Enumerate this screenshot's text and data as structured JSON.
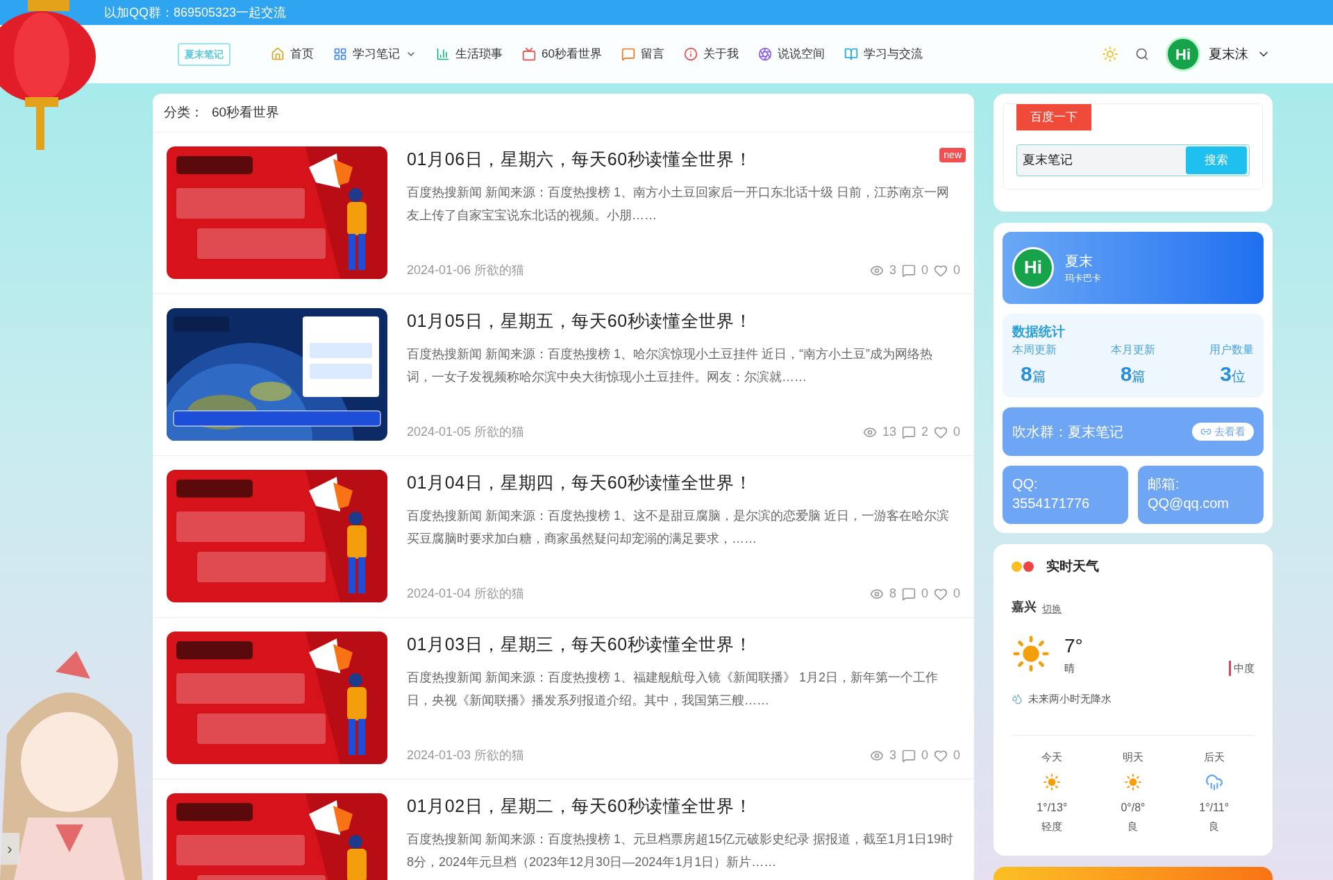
{
  "top_banner": "以加QQ群：869505323一起交流",
  "logo": "夏末笔记",
  "nav": [
    {
      "label": "首页",
      "dropdown": false
    },
    {
      "label": "学习笔记",
      "dropdown": true
    },
    {
      "label": "生活琐事",
      "dropdown": false
    },
    {
      "label": "60秒看世界",
      "dropdown": false
    },
    {
      "label": "留言",
      "dropdown": false
    },
    {
      "label": "关于我",
      "dropdown": false
    },
    {
      "label": "说说空间",
      "dropdown": false
    },
    {
      "label": "学习与交流",
      "dropdown": false
    }
  ],
  "user": {
    "avatar": "Hi",
    "name": "夏末沫"
  },
  "category": {
    "label": "分类：",
    "value": "60秒看世界"
  },
  "articles": [
    {
      "title": "01月06日，星期六，每天60秒读懂全世界！",
      "excerpt": "百度热搜新闻 新闻来源：百度热搜榜 1、南方小土豆回家后一开口东北话十级 日前，江苏南京一网友上传了自家宝宝说东北话的视频。小朋……",
      "date": "2024-01-06",
      "author": "所欲的猫",
      "views": "3",
      "comments": "0",
      "likes": "0",
      "badge": "new"
    },
    {
      "title": "01月05日，星期五，每天60秒读懂全世界！",
      "excerpt": "百度热搜新闻 新闻来源：百度热搜榜 1、哈尔滨惊现小土豆挂件 近日，“南方小土豆”成为网络热词，一女子发视频称哈尔滨中央大街惊现小土豆挂件。网友：尔滨就……",
      "date": "2024-01-05",
      "author": "所欲的猫",
      "views": "13",
      "comments": "2",
      "likes": "0"
    },
    {
      "title": "01月04日，星期四，每天60秒读懂全世界！",
      "excerpt": "百度热搜新闻 新闻来源：百度热搜榜 1、这不是甜豆腐脑，是尔滨的恋爱脑 近日，一游客在哈尔滨买豆腐脑时要求加白糖，商家虽然疑问却宠溺的满足要求，……",
      "date": "2024-01-04",
      "author": "所欲的猫",
      "views": "8",
      "comments": "0",
      "likes": "0"
    },
    {
      "title": "01月03日，星期三，每天60秒读懂全世界！",
      "excerpt": "百度热搜新闻 新闻来源：百度热搜榜 1、福建舰航母入镜《新闻联播》 1月2日，新年第一个工作日，央视《新闻联播》播发系列报道介绍。其中，我国第三艘……",
      "date": "2024-01-03",
      "author": "所欲的猫",
      "views": "3",
      "comments": "0",
      "likes": "0"
    },
    {
      "title": "01月02日，星期二，每天60秒读懂全世界！",
      "excerpt": "百度热搜新闻 新闻来源：百度热搜榜 1、元旦档票房超15亿元破影史纪录 据报道，截至1月1日19时8分，2024年元旦档（2023年12月30日—2024年1月1日）新片……"
    }
  ],
  "baidu": {
    "tab": "百度一下",
    "value": "夏末笔记",
    "button": "搜索"
  },
  "profile": {
    "avatar": "Hi",
    "name": "夏末",
    "subtitle": "玛卡巴卡"
  },
  "stats": {
    "title": "数据统计",
    "items": [
      {
        "label": "本周更新",
        "number": "8",
        "unit": "篇"
      },
      {
        "label": "本月更新",
        "number": "8",
        "unit": "篇"
      },
      {
        "label": "用户数量",
        "number": "3",
        "unit": "位"
      }
    ]
  },
  "group": {
    "text": "吹水群：夏末笔记",
    "button": "去看看"
  },
  "contacts": [
    {
      "label": "QQ:",
      "value": "3554171776"
    },
    {
      "label": "邮箱:",
      "value": "QQ@qq.com"
    }
  ],
  "weather": {
    "title": "实时天气",
    "dots": [
      {
        "color": "#fbbf24"
      },
      {
        "color": "#ef4444"
      }
    ],
    "city": "嘉兴",
    "switch": "切换",
    "temp": "7°",
    "condition": "晴",
    "aqi": "中度",
    "rain": "未来两小时无降水",
    "forecast": [
      {
        "day": "今天",
        "kind": "sun",
        "range": "1°/13°",
        "aqi": "轻度"
      },
      {
        "day": "明天",
        "kind": "sun",
        "range": "0°/8°",
        "aqi": "良"
      },
      {
        "day": "后天",
        "kind": "rain",
        "range": "1°/11°",
        "aqi": "良"
      }
    ]
  },
  "side_toggle": "›"
}
